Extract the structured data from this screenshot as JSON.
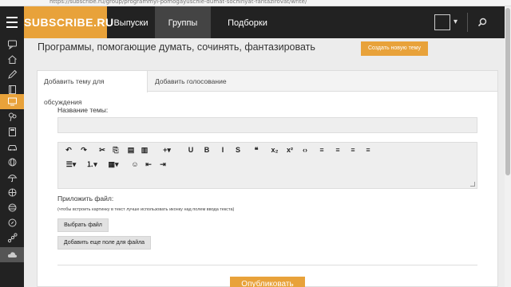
{
  "browser": {
    "url": "https://subscribe.ru/group/programmyi-pomogayuschie-dumat-sochinyat-fantazirovat/write/"
  },
  "header": {
    "logo": "SUBSCRIBE.RU",
    "nav": [
      {
        "label": "Выпуски"
      },
      {
        "label": "Группы",
        "active": true
      },
      {
        "label": "Подборки"
      }
    ],
    "icons": [
      "hamburger-icon",
      "square-icon",
      "chevron-down-icon",
      "search-icon"
    ]
  },
  "sidebar": {
    "icons": [
      "chat-icon",
      "home-icon",
      "pencil-icon",
      "book-icon",
      "monitor-icon",
      "balloons-icon",
      "calculator-icon",
      "car-icon",
      "globe-icon",
      "umbrella-icon",
      "sports-ball-icon",
      "globe-network-icon",
      "compass-icon",
      "molecule-icon",
      "cloud-icon"
    ],
    "active_index": 4
  },
  "page": {
    "title": "Программы, помогающие думать, сочинять, фантазировать",
    "create_button": "Создать новую тему"
  },
  "tabs": [
    {
      "label": "Добавить тему для обсуждения",
      "active": true
    },
    {
      "label": "Добавить голосование"
    }
  ],
  "form": {
    "topic_label": "Название темы:",
    "topic_value": "",
    "attach_label": "Приложить файл:",
    "attach_hint": "(чтобы встроить картинку в текст лучше использовать иконку  над полем ввода текста)",
    "choose_file": "Выбрать файл",
    "add_field": "Добавить еще поле для файла",
    "publish": "Опубликовать"
  },
  "toolbar": {
    "row1": [
      {
        "name": "undo-icon",
        "glyph": "↶"
      },
      {
        "name": "redo-icon",
        "glyph": "↷"
      },
      {
        "name": "cut-icon",
        "glyph": "✂"
      },
      {
        "name": "copy-icon",
        "glyph": "⎘"
      },
      {
        "name": "paste-icon",
        "glyph": "▤"
      },
      {
        "name": "paste-text-icon",
        "glyph": "▥"
      },
      {
        "name": "insert-plus-icon",
        "glyph": "+▾"
      },
      {
        "name": "underline-icon",
        "glyph": "U"
      },
      {
        "name": "bold-icon",
        "glyph": "B"
      },
      {
        "name": "italic-icon",
        "glyph": "I"
      },
      {
        "name": "strikethrough-icon",
        "glyph": "S"
      },
      {
        "name": "quote-icon",
        "glyph": "❝"
      },
      {
        "name": "subscript-icon",
        "glyph": "x₂"
      },
      {
        "name": "superscript-icon",
        "glyph": "x²"
      },
      {
        "name": "code-icon",
        "glyph": "‹›"
      },
      {
        "name": "align-left-icon",
        "glyph": "≡"
      },
      {
        "name": "align-center-icon",
        "glyph": "≡"
      },
      {
        "name": "align-right-icon",
        "glyph": "≡"
      },
      {
        "name": "align-justify-icon",
        "glyph": "≡"
      }
    ],
    "row2": [
      {
        "name": "bullet-list-icon",
        "glyph": "☰▾"
      },
      {
        "name": "numbered-list-icon",
        "glyph": "⒈▾"
      },
      {
        "name": "table-icon",
        "glyph": "▦▾"
      },
      {
        "name": "emoji-icon",
        "glyph": "☺"
      },
      {
        "name": "outdent-icon",
        "glyph": "⇤"
      },
      {
        "name": "indent-icon",
        "glyph": "⇥"
      }
    ]
  },
  "colors": {
    "accent": "#e8a23a",
    "dark": "#222222"
  }
}
